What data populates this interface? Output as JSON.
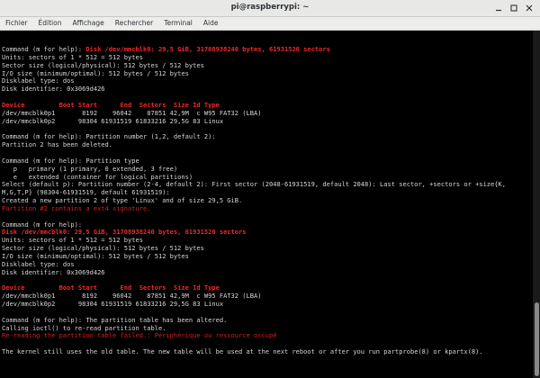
{
  "window": {
    "title": "pi@raspberrypi: ~"
  },
  "menu": {
    "items": [
      "Fichier",
      "Édition",
      "Affichage",
      "Rechercher",
      "Terminal",
      "Aide"
    ]
  },
  "icons": {
    "minimize": "minimize-icon",
    "maximize": "maximize-icon",
    "close": "close-icon"
  },
  "colors": {
    "terminal_background": "#000000",
    "terminal_text": "#d6d6d6",
    "highlight_red": "#ef2929",
    "error_red": "#cc2222"
  },
  "terminal": {
    "lines": [
      [
        {
          "t": "Command (m for help): ",
          "c": "w"
        },
        {
          "t": "Disk /dev/mmcblk0: 29,5 GiB, 31708938240 bytes, 61931520 sectors",
          "c": "rb"
        }
      ],
      [
        {
          "t": "Units: sectors of 1 * 512 = 512 bytes",
          "c": "w"
        }
      ],
      [
        {
          "t": "Sector size (logical/physical): 512 bytes / 512 bytes",
          "c": "w"
        }
      ],
      [
        {
          "t": "I/O size (minimum/optimal): 512 bytes / 512 bytes",
          "c": "w"
        }
      ],
      [
        {
          "t": "Disklabel type: dos",
          "c": "w"
        }
      ],
      [
        {
          "t": "Disk identifier: 0x3069d426",
          "c": "w"
        }
      ],
      [
        {
          "t": "",
          "c": "w"
        }
      ],
      [
        {
          "t": "Device         Boot Start      End  Sectors  Size Id Type",
          "c": "rb"
        }
      ],
      [
        {
          "t": "/dev/mmcblk0p1       8192    96042    87851 42,9M  c W95 FAT32 (LBA)",
          "c": "w"
        }
      ],
      [
        {
          "t": "/dev/mmcblk0p2      98304 61931519 61833216 29,5G 83 Linux",
          "c": "w"
        }
      ],
      [
        {
          "t": "",
          "c": "w"
        }
      ],
      [
        {
          "t": "Command (m for help): Partition number (1,2, default 2):",
          "c": "w"
        }
      ],
      [
        {
          "t": "Partition 2 has been deleted.",
          "c": "w"
        }
      ],
      [
        {
          "t": "",
          "c": "w"
        }
      ],
      [
        {
          "t": "Command (m for help): Partition type",
          "c": "w"
        }
      ],
      [
        {
          "t": "   p   primary (1 primary, 0 extended, 3 free)",
          "c": "w"
        }
      ],
      [
        {
          "t": "   e   extended (container for logical partitions)",
          "c": "w"
        }
      ],
      [
        {
          "t": "Select (default p): Partition number (2-4, default 2): First sector (2048-61931519, default 2048): Last sector, +sectors or +size{K,",
          "c": "w"
        }
      ],
      [
        {
          "t": "M,G,T,P} (98304-61931519, default 61931519):",
          "c": "w"
        }
      ],
      [
        {
          "t": "Created a new partition 2 of type 'Linux' and of size 29,5 GiB.",
          "c": "w"
        }
      ],
      [
        {
          "t": "Partition #2 contains a ext4 signature.",
          "c": "r"
        }
      ],
      [
        {
          "t": "",
          "c": "w"
        }
      ],
      [
        {
          "t": "Command (m for help):",
          "c": "w"
        }
      ],
      [
        {
          "t": "Disk /dev/mmcblk0: 29,5 GiB, 31708938240 bytes, 61931520 sectors",
          "c": "rb"
        }
      ],
      [
        {
          "t": "Units: sectors of 1 * 512 = 512 bytes",
          "c": "w"
        }
      ],
      [
        {
          "t": "Sector size (logical/physical): 512 bytes / 512 bytes",
          "c": "w"
        }
      ],
      [
        {
          "t": "I/O size (minimum/optimal): 512 bytes / 512 bytes",
          "c": "w"
        }
      ],
      [
        {
          "t": "Disklabel type: dos",
          "c": "w"
        }
      ],
      [
        {
          "t": "Disk identifier: 0x3069d426",
          "c": "w"
        }
      ],
      [
        {
          "t": "",
          "c": "w"
        }
      ],
      [
        {
          "t": "Device         Boot Start      End  Sectors  Size Id Type",
          "c": "rb"
        }
      ],
      [
        {
          "t": "/dev/mmcblk0p1       8192    96042    87851 42,9M  c W95 FAT32 (LBA)",
          "c": "w"
        }
      ],
      [
        {
          "t": "/dev/mmcblk0p2      98304 61931519 61833216 29,5G 83 Linux",
          "c": "w"
        }
      ],
      [
        {
          "t": "",
          "c": "w"
        }
      ],
      [
        {
          "t": "Command (m for help): The partition table has been altered.",
          "c": "w"
        }
      ],
      [
        {
          "t": "Calling ioctl() to re-read partition table.",
          "c": "w"
        }
      ],
      [
        {
          "t": "Re-reading the partition table failed.: Périphérique ou ressource occupé",
          "c": "r"
        }
      ],
      [
        {
          "t": "",
          "c": "w"
        }
      ],
      [
        {
          "t": "The kernel still uses the old table. The new table will be used at the next reboot or after you run partprobe(8) or kpartx(8).",
          "c": "w"
        }
      ],
      [
        {
          "t": "",
          "c": "w"
        }
      ]
    ]
  }
}
